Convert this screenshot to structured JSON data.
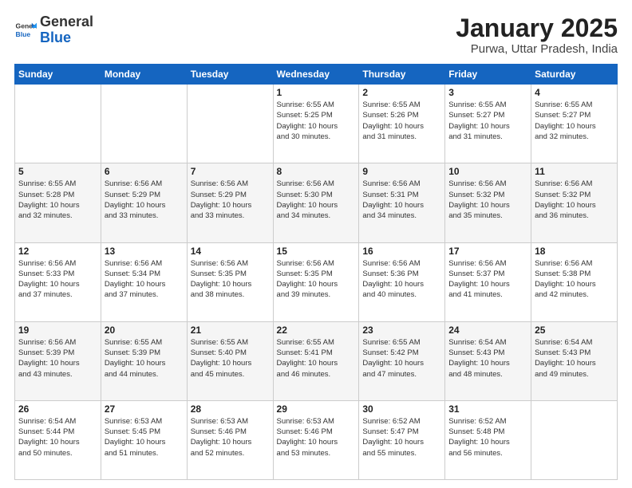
{
  "header": {
    "logo_general": "General",
    "logo_blue": "Blue",
    "title": "January 2025",
    "location": "Purwa, Uttar Pradesh, India"
  },
  "weekdays": [
    "Sunday",
    "Monday",
    "Tuesday",
    "Wednesday",
    "Thursday",
    "Friday",
    "Saturday"
  ],
  "weeks": [
    [
      {
        "day": "",
        "info": ""
      },
      {
        "day": "",
        "info": ""
      },
      {
        "day": "",
        "info": ""
      },
      {
        "day": "1",
        "info": "Sunrise: 6:55 AM\nSunset: 5:25 PM\nDaylight: 10 hours\nand 30 minutes."
      },
      {
        "day": "2",
        "info": "Sunrise: 6:55 AM\nSunset: 5:26 PM\nDaylight: 10 hours\nand 31 minutes."
      },
      {
        "day": "3",
        "info": "Sunrise: 6:55 AM\nSunset: 5:27 PM\nDaylight: 10 hours\nand 31 minutes."
      },
      {
        "day": "4",
        "info": "Sunrise: 6:55 AM\nSunset: 5:27 PM\nDaylight: 10 hours\nand 32 minutes."
      }
    ],
    [
      {
        "day": "5",
        "info": "Sunrise: 6:55 AM\nSunset: 5:28 PM\nDaylight: 10 hours\nand 32 minutes."
      },
      {
        "day": "6",
        "info": "Sunrise: 6:56 AM\nSunset: 5:29 PM\nDaylight: 10 hours\nand 33 minutes."
      },
      {
        "day": "7",
        "info": "Sunrise: 6:56 AM\nSunset: 5:29 PM\nDaylight: 10 hours\nand 33 minutes."
      },
      {
        "day": "8",
        "info": "Sunrise: 6:56 AM\nSunset: 5:30 PM\nDaylight: 10 hours\nand 34 minutes."
      },
      {
        "day": "9",
        "info": "Sunrise: 6:56 AM\nSunset: 5:31 PM\nDaylight: 10 hours\nand 34 minutes."
      },
      {
        "day": "10",
        "info": "Sunrise: 6:56 AM\nSunset: 5:32 PM\nDaylight: 10 hours\nand 35 minutes."
      },
      {
        "day": "11",
        "info": "Sunrise: 6:56 AM\nSunset: 5:32 PM\nDaylight: 10 hours\nand 36 minutes."
      }
    ],
    [
      {
        "day": "12",
        "info": "Sunrise: 6:56 AM\nSunset: 5:33 PM\nDaylight: 10 hours\nand 37 minutes."
      },
      {
        "day": "13",
        "info": "Sunrise: 6:56 AM\nSunset: 5:34 PM\nDaylight: 10 hours\nand 37 minutes."
      },
      {
        "day": "14",
        "info": "Sunrise: 6:56 AM\nSunset: 5:35 PM\nDaylight: 10 hours\nand 38 minutes."
      },
      {
        "day": "15",
        "info": "Sunrise: 6:56 AM\nSunset: 5:35 PM\nDaylight: 10 hours\nand 39 minutes."
      },
      {
        "day": "16",
        "info": "Sunrise: 6:56 AM\nSunset: 5:36 PM\nDaylight: 10 hours\nand 40 minutes."
      },
      {
        "day": "17",
        "info": "Sunrise: 6:56 AM\nSunset: 5:37 PM\nDaylight: 10 hours\nand 41 minutes."
      },
      {
        "day": "18",
        "info": "Sunrise: 6:56 AM\nSunset: 5:38 PM\nDaylight: 10 hours\nand 42 minutes."
      }
    ],
    [
      {
        "day": "19",
        "info": "Sunrise: 6:56 AM\nSunset: 5:39 PM\nDaylight: 10 hours\nand 43 minutes."
      },
      {
        "day": "20",
        "info": "Sunrise: 6:55 AM\nSunset: 5:39 PM\nDaylight: 10 hours\nand 44 minutes."
      },
      {
        "day": "21",
        "info": "Sunrise: 6:55 AM\nSunset: 5:40 PM\nDaylight: 10 hours\nand 45 minutes."
      },
      {
        "day": "22",
        "info": "Sunrise: 6:55 AM\nSunset: 5:41 PM\nDaylight: 10 hours\nand 46 minutes."
      },
      {
        "day": "23",
        "info": "Sunrise: 6:55 AM\nSunset: 5:42 PM\nDaylight: 10 hours\nand 47 minutes."
      },
      {
        "day": "24",
        "info": "Sunrise: 6:54 AM\nSunset: 5:43 PM\nDaylight: 10 hours\nand 48 minutes."
      },
      {
        "day": "25",
        "info": "Sunrise: 6:54 AM\nSunset: 5:43 PM\nDaylight: 10 hours\nand 49 minutes."
      }
    ],
    [
      {
        "day": "26",
        "info": "Sunrise: 6:54 AM\nSunset: 5:44 PM\nDaylight: 10 hours\nand 50 minutes."
      },
      {
        "day": "27",
        "info": "Sunrise: 6:53 AM\nSunset: 5:45 PM\nDaylight: 10 hours\nand 51 minutes."
      },
      {
        "day": "28",
        "info": "Sunrise: 6:53 AM\nSunset: 5:46 PM\nDaylight: 10 hours\nand 52 minutes."
      },
      {
        "day": "29",
        "info": "Sunrise: 6:53 AM\nSunset: 5:46 PM\nDaylight: 10 hours\nand 53 minutes."
      },
      {
        "day": "30",
        "info": "Sunrise: 6:52 AM\nSunset: 5:47 PM\nDaylight: 10 hours\nand 55 minutes."
      },
      {
        "day": "31",
        "info": "Sunrise: 6:52 AM\nSunset: 5:48 PM\nDaylight: 10 hours\nand 56 minutes."
      },
      {
        "day": "",
        "info": ""
      }
    ]
  ]
}
